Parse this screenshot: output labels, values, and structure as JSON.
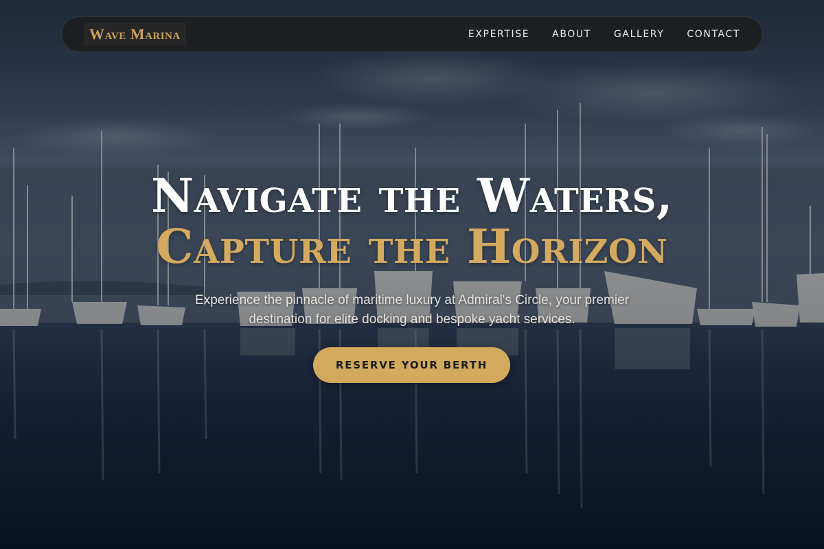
{
  "brand": {
    "name": "Wave Marina",
    "accent_color": "#d4aa60"
  },
  "nav": {
    "items": [
      {
        "label": "EXPERTISE"
      },
      {
        "label": "ABOUT"
      },
      {
        "label": "GALLERY"
      },
      {
        "label": "CONTACT"
      }
    ]
  },
  "hero": {
    "headline_line1": "Navigate the Waters,",
    "headline_line2": "Capture the Horizon",
    "subtitle": "Experience the pinnacle of maritime luxury at Admiral's Circle, your premier destination for elite docking and bespoke yacht services.",
    "cta_label": "RESERVE YOUR BERTH",
    "background_image": "marina-at-dusk"
  }
}
